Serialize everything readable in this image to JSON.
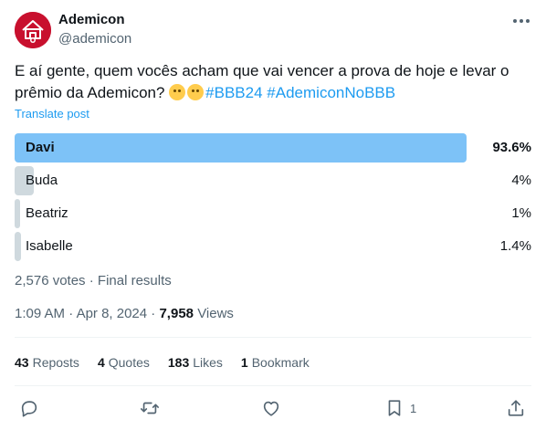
{
  "author": {
    "name": "Ademicon",
    "handle": "@ademicon"
  },
  "tweet": {
    "text_before_emoji": "E aí gente, quem vocês acham que vai vencer a prova de hoje e levar o prêmio da Ademicon?",
    "hashtags": [
      "#BBB24",
      "#AdemiconNoBBB"
    ],
    "translate_label": "Translate post"
  },
  "poll": {
    "options": [
      {
        "label": "Davi",
        "percent_text": "93.6%",
        "share": 0.936,
        "winner": true
      },
      {
        "label": "Buda",
        "percent_text": "4%",
        "share": 0.04,
        "winner": false
      },
      {
        "label": "Beatriz",
        "percent_text": "1%",
        "share": 0.01,
        "winner": false
      },
      {
        "label": "Isabelle",
        "percent_text": "1.4%",
        "share": 0.014,
        "winner": false
      }
    ],
    "votes": "2,576 votes",
    "separator": " · ",
    "status": "Final results"
  },
  "meta": {
    "time": "1:09 AM",
    "date": "Apr 8, 2024",
    "views_count": "7,958",
    "views_label": "Views"
  },
  "stats": {
    "reposts_count": "43",
    "reposts_label": "Reposts",
    "quotes_count": "4",
    "quotes_label": "Quotes",
    "likes_count": "183",
    "likes_label": "Likes",
    "bookmarks_count": "1",
    "bookmarks_label": "Bookmark"
  },
  "actions": {
    "reply_icon": "reply-icon",
    "repost_icon": "repost-icon",
    "like_icon": "heart-icon",
    "bookmark_icon": "bookmark-icon",
    "bookmark_count": "1",
    "share_icon": "share-icon"
  },
  "colors": {
    "accent": "#1d9bf0",
    "winner_bar": "#7dc2f7",
    "bar": "#cfd9de",
    "brand": "#c8102e"
  }
}
